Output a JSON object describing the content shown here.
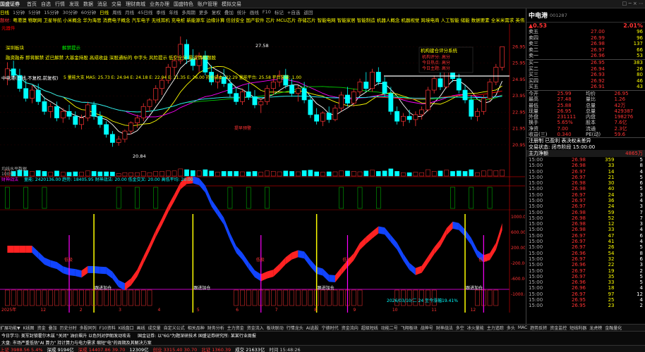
{
  "menu": {
    "logo": "国盛证券",
    "items": [
      "首页",
      "自选",
      "行情",
      "发现",
      "数据",
      "消息",
      "交易",
      "理财商城",
      "业务办理",
      "国盛特色",
      "账户管理",
      "模拟交易"
    ],
    "window_controls": "□ ─ × ⋯"
  },
  "period": {
    "items": [
      "日线",
      "1分钟",
      "5分钟",
      "15分钟",
      "30分钟",
      "60分钟",
      "日线",
      "周线",
      "月线",
      "45日线",
      "季线",
      "年线",
      "多周期",
      "更多",
      "复权",
      "叠加",
      "统计",
      "画线",
      "F10",
      "标记",
      "+自选",
      "返回"
    ],
    "active": "日线"
  },
  "concepts": {
    "prefix": "题材:",
    "text": "粤港澳 物联网 卫星导航 小米概念 华为海思 消费电子概念 汽车电子 无线耳机 充电桩 新能源车 边缘计算 信创安全 国产软件 芯片 MCU芯片 存储芯片 智能电网 智能家居 智能制造 机器人概念 机器视觉 跨境电商 人工智能 储能 数据要素 全米米需求 英伟达概念 星闪概念"
  },
  "overlays": {
    "signal_red_box": "元器件",
    "signal_hot": "深圳板块",
    "signal_break": "解禁提示",
    "line3": "融资融券 即将解禁 近已解禁 大基金持股 高成收益 深股通标的 中字头 风险提示 低空全分 最近情绪题股",
    "ma_title": "中电港(日线,不复权,前复权)",
    "ma_values": "5 量能大支 MA5: 25.73  E: 24.94  E: 24.18  E: 22.94  E: 21.35  E: 26.00  持仓成本: 22.29  量能平台: 25.58  平台突破: 1.00",
    "price_max": "27.58",
    "price_min": "20.84",
    "annotation_box_title": "机构建仓评分系统",
    "annotation_box_lines": [
      "机构评分: 高分",
      "今日热点: 高分",
      "今日主题: 高分"
    ],
    "early_warn": "提早预警",
    "start_signal": "起涨",
    "volume_label": "均线水平数据",
    "volume_sub": "100天",
    "macd_label": "财神战法",
    "macd_values": "量能: 2420136.00  趋势: 18405.95  财神战法: 20.00  低金交叉: 20.00  高低平均: 20.00"
  },
  "chart_data": {
    "type": "candlestick",
    "title": "中电港(日线,不复权,前复权)",
    "ylim": [
      20,
      28
    ],
    "y_ticks": [
      "26.95",
      "25.95",
      "24.95",
      "23.95",
      "22.95",
      "21.95",
      "20.95"
    ],
    "x_ticks": [
      "2025年",
      "12",
      "2",
      "3",
      "4",
      "5",
      "6",
      "7",
      "8",
      "9",
      "10",
      "11",
      "12"
    ],
    "high": 27.58,
    "low": 20.84,
    "last": 26.95,
    "ind_y_ticks": [
      "1000.00",
      "600.00",
      "200.00",
      "-200.00",
      "-600.00",
      "-1000.00"
    ],
    "cursor_info": "2026/03/10/二 24  至今涨幅19.41%",
    "signals": [
      "低吸",
      "低吸",
      "低吸",
      "低吸"
    ],
    "cross_signals": [
      "跟进加仓",
      "跟进加仓",
      "跟进加仓",
      "跟进加仓"
    ],
    "candles": [
      {
        "o": 25.0,
        "h": 26.0,
        "l": 24.6,
        "c": 25.6
      },
      {
        "o": 25.6,
        "h": 26.1,
        "l": 25.0,
        "c": 25.2
      },
      {
        "o": 25.2,
        "h": 25.6,
        "l": 24.2,
        "c": 24.4
      },
      {
        "o": 24.4,
        "h": 24.9,
        "l": 23.6,
        "c": 23.8
      },
      {
        "o": 23.8,
        "h": 24.6,
        "l": 23.5,
        "c": 24.3
      },
      {
        "o": 24.3,
        "h": 24.7,
        "l": 23.4,
        "c": 23.6
      },
      {
        "o": 23.6,
        "h": 23.9,
        "l": 22.8,
        "c": 23.0
      },
      {
        "o": 23.0,
        "h": 23.5,
        "l": 22.6,
        "c": 23.3
      },
      {
        "o": 23.3,
        "h": 23.6,
        "l": 22.4,
        "c": 22.6
      },
      {
        "o": 22.6,
        "h": 23.2,
        "l": 22.3,
        "c": 23.0
      },
      {
        "o": 23.0,
        "h": 23.4,
        "l": 22.5,
        "c": 22.7
      },
      {
        "o": 22.7,
        "h": 23.0,
        "l": 22.0,
        "c": 22.2
      },
      {
        "o": 22.2,
        "h": 22.8,
        "l": 21.9,
        "c": 22.6
      },
      {
        "o": 22.6,
        "h": 23.6,
        "l": 22.4,
        "c": 23.4
      },
      {
        "o": 23.4,
        "h": 23.6,
        "l": 22.5,
        "c": 22.7
      },
      {
        "o": 22.7,
        "h": 23.0,
        "l": 22.0,
        "c": 22.2
      },
      {
        "o": 22.2,
        "h": 22.4,
        "l": 21.4,
        "c": 21.6
      },
      {
        "o": 21.6,
        "h": 21.8,
        "l": 20.84,
        "c": 21.1
      },
      {
        "o": 21.1,
        "h": 21.5,
        "l": 20.9,
        "c": 21.3
      },
      {
        "o": 21.3,
        "h": 21.9,
        "l": 21.1,
        "c": 21.8
      },
      {
        "o": 21.8,
        "h": 22.4,
        "l": 21.6,
        "c": 22.3
      },
      {
        "o": 22.3,
        "h": 22.8,
        "l": 22.0,
        "c": 22.6
      },
      {
        "o": 22.6,
        "h": 23.5,
        "l": 22.4,
        "c": 23.3
      },
      {
        "o": 23.3,
        "h": 23.8,
        "l": 23.0,
        "c": 23.7
      },
      {
        "o": 23.7,
        "h": 24.6,
        "l": 23.5,
        "c": 24.4
      },
      {
        "o": 24.4,
        "h": 25.1,
        "l": 24.0,
        "c": 24.9
      },
      {
        "o": 24.9,
        "h": 25.9,
        "l": 24.7,
        "c": 25.7
      },
      {
        "o": 25.7,
        "h": 26.4,
        "l": 25.2,
        "c": 26.1
      },
      {
        "o": 26.1,
        "h": 27.58,
        "l": 25.9,
        "c": 27.1
      },
      {
        "o": 27.1,
        "h": 27.4,
        "l": 25.9,
        "c": 26.2
      },
      {
        "o": 26.2,
        "h": 26.8,
        "l": 25.5,
        "c": 25.8
      },
      {
        "o": 25.8,
        "h": 26.6,
        "l": 25.4,
        "c": 26.4
      },
      {
        "o": 26.4,
        "h": 26.7,
        "l": 25.2,
        "c": 25.4
      },
      {
        "o": 25.4,
        "h": 25.8,
        "l": 24.6,
        "c": 24.8
      },
      {
        "o": 24.8,
        "h": 25.3,
        "l": 24.4,
        "c": 25.1
      },
      {
        "o": 25.1,
        "h": 25.6,
        "l": 24.5,
        "c": 24.7
      },
      {
        "o": 24.7,
        "h": 25.0,
        "l": 23.9,
        "c": 24.1
      },
      {
        "o": 24.1,
        "h": 24.5,
        "l": 23.4,
        "c": 23.6
      },
      {
        "o": 23.6,
        "h": 24.4,
        "l": 23.4,
        "c": 24.2
      },
      {
        "o": 24.2,
        "h": 24.7,
        "l": 23.7,
        "c": 23.9
      },
      {
        "o": 23.9,
        "h": 24.3,
        "l": 23.2,
        "c": 23.4
      },
      {
        "o": 23.4,
        "h": 23.8,
        "l": 22.9,
        "c": 23.6
      },
      {
        "o": 23.6,
        "h": 24.6,
        "l": 23.4,
        "c": 24.4
      },
      {
        "o": 24.4,
        "h": 25.1,
        "l": 24.0,
        "c": 24.8
      },
      {
        "o": 24.8,
        "h": 25.5,
        "l": 24.5,
        "c": 25.2
      },
      {
        "o": 25.2,
        "h": 25.6,
        "l": 24.4,
        "c": 24.6
      },
      {
        "o": 24.6,
        "h": 25.0,
        "l": 23.9,
        "c": 24.1
      },
      {
        "o": 24.1,
        "h": 24.6,
        "l": 23.6,
        "c": 24.4
      },
      {
        "o": 24.4,
        "h": 24.8,
        "l": 23.5,
        "c": 23.7
      },
      {
        "o": 23.7,
        "h": 24.0,
        "l": 22.6,
        "c": 22.8
      },
      {
        "o": 22.8,
        "h": 23.2,
        "l": 22.2,
        "c": 22.4
      },
      {
        "o": 22.4,
        "h": 23.0,
        "l": 22.1,
        "c": 22.9
      },
      {
        "o": 22.9,
        "h": 23.3,
        "l": 22.3,
        "c": 22.5
      },
      {
        "o": 22.5,
        "h": 23.4,
        "l": 22.4,
        "c": 23.2
      },
      {
        "o": 23.2,
        "h": 24.2,
        "l": 23.0,
        "c": 24.0
      },
      {
        "o": 24.0,
        "h": 24.5,
        "l": 23.3,
        "c": 23.5
      },
      {
        "o": 23.5,
        "h": 24.4,
        "l": 23.3,
        "c": 24.2
      },
      {
        "o": 24.2,
        "h": 25.0,
        "l": 24.0,
        "c": 24.8
      },
      {
        "o": 24.8,
        "h": 25.4,
        "l": 24.2,
        "c": 24.4
      },
      {
        "o": 24.4,
        "h": 25.6,
        "l": 24.2,
        "c": 25.4
      },
      {
        "o": 25.4,
        "h": 25.7,
        "l": 24.6,
        "c": 24.8
      },
      {
        "o": 24.8,
        "h": 25.1,
        "l": 23.9,
        "c": 24.1
      },
      {
        "o": 24.1,
        "h": 24.5,
        "l": 22.8,
        "c": 23.0
      },
      {
        "o": 23.0,
        "h": 23.3,
        "l": 22.2,
        "c": 22.4
      },
      {
        "o": 22.4,
        "h": 22.9,
        "l": 22.1,
        "c": 22.7
      },
      {
        "o": 22.7,
        "h": 23.1,
        "l": 22.3,
        "c": 22.5
      },
      {
        "o": 22.5,
        "h": 23.0,
        "l": 22.1,
        "c": 22.8
      },
      {
        "o": 22.8,
        "h": 23.3,
        "l": 22.5,
        "c": 23.1
      },
      {
        "o": 23.1,
        "h": 24.5,
        "l": 23.0,
        "c": 24.3
      },
      {
        "o": 24.3,
        "h": 25.2,
        "l": 24.1,
        "c": 25.0
      },
      {
        "o": 25.0,
        "h": 25.5,
        "l": 24.3,
        "c": 24.5
      },
      {
        "o": 24.5,
        "h": 25.8,
        "l": 24.4,
        "c": 25.6
      },
      {
        "o": 25.6,
        "h": 25.9,
        "l": 24.8,
        "c": 25.0
      },
      {
        "o": 25.0,
        "h": 25.3,
        "l": 24.1,
        "c": 24.3
      },
      {
        "o": 24.3,
        "h": 24.6,
        "l": 23.5,
        "c": 23.7
      },
      {
        "o": 23.7,
        "h": 24.0,
        "l": 22.5,
        "c": 22.7
      },
      {
        "o": 22.7,
        "h": 23.2,
        "l": 22.4,
        "c": 23.0
      },
      {
        "o": 23.0,
        "h": 24.0,
        "l": 22.8,
        "c": 23.8
      },
      {
        "o": 23.8,
        "h": 25.0,
        "l": 23.6,
        "c": 24.8
      },
      {
        "o": 24.8,
        "h": 25.9,
        "l": 24.6,
        "c": 25.7
      },
      {
        "o": 25.7,
        "h": 26.95,
        "l": 25.5,
        "c": 26.95
      }
    ]
  },
  "quote": {
    "name": "中电港",
    "code": "001287",
    "change": "▲0.53",
    "pct": "2.01%",
    "asks": [
      {
        "label": "卖五",
        "price": "27.00",
        "vol": "96"
      },
      {
        "label": "卖四",
        "price": "26.99",
        "vol": "96"
      },
      {
        "label": "卖三",
        "price": "26.98",
        "vol": "137"
      },
      {
        "label": "卖二",
        "price": "26.97",
        "vol": "66"
      },
      {
        "label": "卖一",
        "price": "26.96",
        "vol": "53"
      }
    ],
    "bids": [
      {
        "label": "买一",
        "price": "26.95",
        "vol": "383"
      },
      {
        "label": "买二",
        "price": "26.94",
        "vol": "26"
      },
      {
        "label": "买三",
        "price": "26.93",
        "vol": "80"
      },
      {
        "label": "买四",
        "price": "26.92",
        "vol": "46"
      },
      {
        "label": "买五",
        "price": "26.91",
        "vol": "43"
      }
    ],
    "stats": [
      {
        "l1": "今开",
        "v1": "25.99",
        "l2": "均价",
        "v2": "26.95"
      },
      {
        "l1": "最高",
        "v1": "27.48",
        "l2": "量比",
        "v2": "1.26"
      },
      {
        "l1": "最低",
        "v1": "25.88",
        "l2": "总量",
        "v2": "42万"
      },
      {
        "l1": "现量",
        "v1": "26.95",
        "l2": "总量",
        "v2": "429387"
      },
      {
        "l1": "外盘",
        "v1": "231111",
        "l2": "内盘",
        "v2": "198276"
      },
      {
        "l1": "换手",
        "v1": "5.65%",
        "l2": "股本",
        "v2": "7.6亿"
      },
      {
        "l1": "净资",
        "v1": "7.00",
        "l2": "流通",
        "v2": "2.3亿"
      },
      {
        "l1": "收益(三)",
        "v1": "0.340",
        "l2": "PE(动)",
        "v2": "59.6"
      }
    ],
    "notes": [
      "注册制 已盈利 表决权未差异",
      "交易状态: 闭市阶段 15:00:00"
    ],
    "main_flow": "主力净额",
    "main_flow_val": "4865万",
    "ticks": [
      [
        "26.98",
        "359",
        "5"
      ],
      [
        "26.98",
        "33",
        "8"
      ],
      [
        "26.97",
        "14",
        "4"
      ],
      [
        "26.97",
        "21",
        "5"
      ],
      [
        "26.98",
        "30",
        "6"
      ],
      [
        "26.98",
        "40",
        "5"
      ],
      [
        "26.97",
        "24",
        "3"
      ],
      [
        "26.97",
        "36",
        "4"
      ],
      [
        "26.97",
        "24",
        "3"
      ],
      [
        "26.98",
        "59",
        "7"
      ],
      [
        "26.98",
        "52",
        "7"
      ],
      [
        "26.98",
        "12",
        "3"
      ],
      [
        "26.98",
        "33",
        "4"
      ],
      [
        "26.97",
        "47",
        "6"
      ],
      [
        "26.97",
        "41",
        "4"
      ],
      [
        "26.97",
        "26",
        "5"
      ],
      [
        "26.96",
        "54",
        "8"
      ],
      [
        "26.97",
        "32",
        "6"
      ],
      [
        "26.96",
        "22",
        "3"
      ],
      [
        "26.97",
        "19",
        "2"
      ],
      [
        "26.97",
        "35",
        "5"
      ],
      [
        "26.96",
        "33",
        "5"
      ],
      [
        "26.96",
        "18",
        "4"
      ],
      [
        "26.97",
        "97",
        "12"
      ],
      [
        "26.95",
        "25",
        "4"
      ],
      [
        "26.95",
        "23",
        "2"
      ]
    ]
  },
  "bottom_tabs": [
    "扩展功能▼",
    "K线图",
    "资金",
    "叠加",
    "历史分时",
    "多股同列",
    "F10资料",
    "K线盘口",
    "画线",
    "成交量",
    "自定义公式",
    "相关品种",
    "财务分析",
    "主力资金",
    "资金流入",
    "板块联动",
    "行情龙头",
    "AI选股",
    "宁德时代",
    "资金流向",
    "超级短线",
    "动能二号",
    "飞翔板块",
    "战神号",
    "财神战法",
    "多空",
    "冰火量能",
    "主力追踪",
    "多头",
    "MAC",
    "趋势反转",
    "资金监控",
    "短线利器",
    "龙虎榜",
    "金融量化"
  ],
  "news": {
    "left": "今日学习: 美军封锁霍尔木兹 \"关闭\" 油价飙升 以色列对伊朗发动攻击",
    "mid": "国金证券: 以\"6G\"为题深研技术 国盛证券研究所: 某某行业周报",
    "right": "大盘: 市场严重低估\"AI 算力\" 持计算力与电力需求 缩短\"电\"的周期及其解决方案"
  },
  "status": [
    {
      "label": "上证",
      "value": "3988.56",
      "change": "5.4%",
      "color": "#f33"
    },
    {
      "label": "深成",
      "value": "9194亿",
      "change": "",
      "color": "#fff"
    },
    {
      "label": "深成",
      "value": "14407.86",
      "change": "39.70",
      "color": "#f33"
    },
    {
      "label": "",
      "value": "12309亿",
      "change": "",
      "color": "#fff"
    },
    {
      "label": "创业",
      "value": "3315.40",
      "change": "30.70",
      "color": "#f33"
    },
    {
      "label": "北证",
      "value": "1360.39",
      "change": "",
      "color": "#f33"
    },
    {
      "label": "成交",
      "value": "21633亿",
      "change": "",
      "color": "#fff"
    },
    {
      "label": "时间",
      "value": "15:48:26",
      "change": "",
      "color": "#ccc"
    }
  ]
}
